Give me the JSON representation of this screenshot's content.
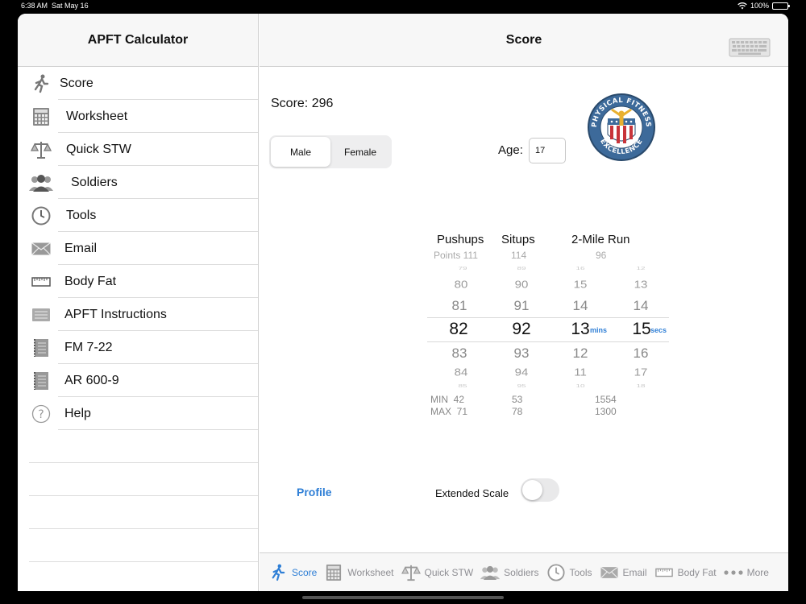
{
  "status": {
    "time": "6:38 AM",
    "date": "Sat May 16",
    "battery": "100%"
  },
  "sidebar": {
    "title": "APFT Calculator",
    "items": [
      {
        "label": "Score",
        "icon": "runner-icon"
      },
      {
        "label": "Worksheet",
        "icon": "calculator-icon"
      },
      {
        "label": "Quick STW",
        "icon": "scale-icon"
      },
      {
        "label": "Soldiers",
        "icon": "group-icon"
      },
      {
        "label": "Tools",
        "icon": "clock-icon"
      },
      {
        "label": "Email",
        "icon": "envelope-icon"
      },
      {
        "label": "Body Fat",
        "icon": "tape-measure-icon"
      },
      {
        "label": "APFT Instructions",
        "icon": "list-icon"
      },
      {
        "label": "FM 7-22",
        "icon": "notebook-icon"
      },
      {
        "label": "AR 600-9",
        "icon": "notebook-icon"
      },
      {
        "label": "Help",
        "icon": "question-icon"
      }
    ]
  },
  "detail": {
    "title": "Score",
    "score_label": "Score: 296",
    "gender": {
      "options": [
        "Male",
        "Female"
      ],
      "selected": "Male"
    },
    "age_label": "Age:",
    "age_value": "17",
    "picker": {
      "pushups": {
        "header": "Pushups",
        "points": "Points 111",
        "rows": [
          "79",
          "80",
          "81",
          "82",
          "83",
          "84",
          "85"
        ],
        "min": "MIN  42",
        "max": "MAX  71"
      },
      "situps": {
        "header": "Situps",
        "points": "114",
        "rows": [
          "89",
          "90",
          "91",
          "92",
          "93",
          "94",
          "95"
        ],
        "min": "53",
        "max": "78"
      },
      "run": {
        "header": "2-Mile Run",
        "points": "96",
        "mins": [
          "16",
          "15",
          "14",
          "13",
          "12",
          "11",
          "10"
        ],
        "secs": [
          "12",
          "13",
          "14",
          "15",
          "16",
          "17",
          "18"
        ],
        "mins_unit": "mins",
        "secs_unit": "secs",
        "min": "1554",
        "max": "1300"
      }
    },
    "profile": "Profile",
    "extended_scale": "Extended Scale",
    "extended_scale_on": false
  },
  "tabbar": {
    "tabs": [
      {
        "label": "Score",
        "active": true
      },
      {
        "label": "Worksheet"
      },
      {
        "label": "Quick STW"
      },
      {
        "label": "Soldiers"
      },
      {
        "label": "Tools"
      },
      {
        "label": "Email"
      },
      {
        "label": "Body Fat"
      },
      {
        "label": "More"
      }
    ]
  },
  "colors": {
    "accent": "#2f7fd6",
    "badge_blue": "#3d6a9a",
    "badge_red": "#c8343a"
  }
}
